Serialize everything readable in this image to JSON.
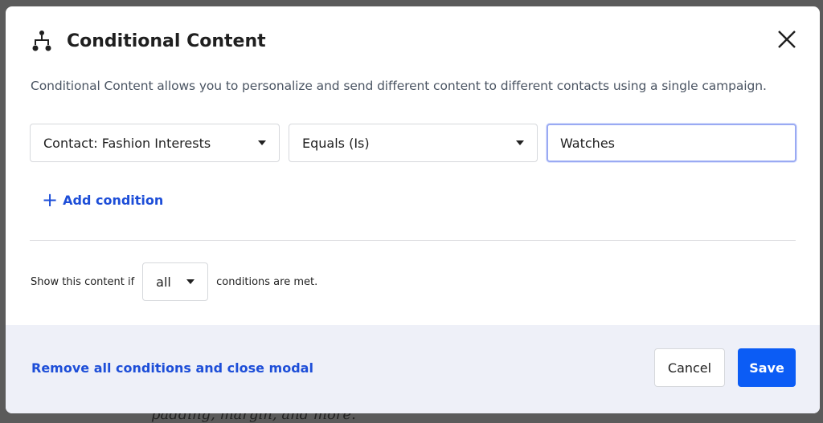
{
  "background": {
    "text": "padding, margin, and more."
  },
  "modal": {
    "title": "Conditional Content",
    "icon": "branch-icon",
    "description": "Conditional Content allows you to personalize and send different content to different contacts using a single campaign.",
    "condition": {
      "field": "Contact: Fashion Interests",
      "operator": "Equals (Is)",
      "value": "Watches"
    },
    "add_condition_label": "Add condition",
    "match": {
      "prefix": "Show this content if",
      "value": "all",
      "suffix": "conditions are met."
    },
    "footer": {
      "remove_label": "Remove all conditions and close modal",
      "cancel_label": "Cancel",
      "save_label": "Save"
    },
    "colors": {
      "accent": "#0b5cf5",
      "link": "#1d4ed8",
      "footer_bg": "#eef0f8"
    }
  }
}
